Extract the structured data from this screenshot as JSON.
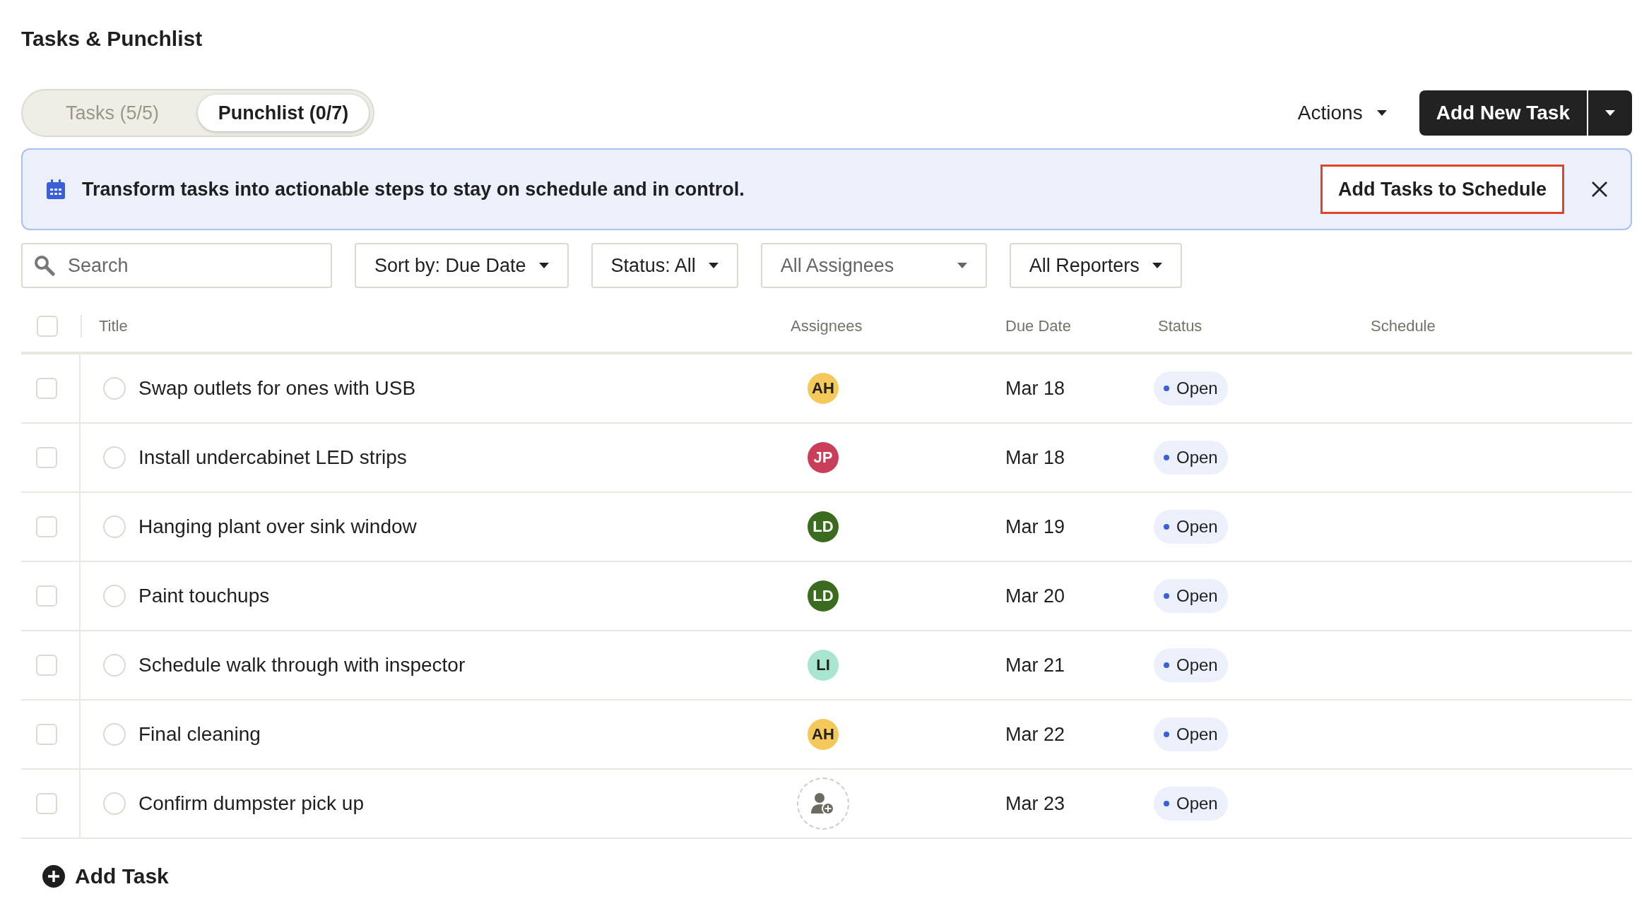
{
  "page_title": "Tasks & Punchlist",
  "tabs": [
    {
      "label": "Tasks (5/5)",
      "selected": false
    },
    {
      "label": "Punchlist (0/7)",
      "selected": true
    }
  ],
  "actions_menu": "Actions",
  "add_new_task": "Add New Task",
  "banner": {
    "message": "Transform tasks into actionable steps to stay on schedule and in control.",
    "button": "Add Tasks to Schedule"
  },
  "search": {
    "placeholder": "Search"
  },
  "filters": [
    {
      "label": "Sort by: Due Date",
      "placeholder": false
    },
    {
      "label": "Status: All",
      "placeholder": false
    },
    {
      "label": "All Assignees",
      "placeholder": true
    },
    {
      "label": "All Reporters",
      "placeholder": false
    }
  ],
  "table": {
    "select_all_checked": false,
    "columns": [
      "Title",
      "Assignees",
      "Due Date",
      "Status",
      "Schedule"
    ],
    "rows": [
      {
        "checked": false,
        "done": false,
        "title": "Swap outlets for ones with USB",
        "assignee": {
          "kind": "initials",
          "initials": "AH",
          "color": "#f5c85a"
        },
        "due_date": "Mar 18",
        "status": {
          "label": "Open",
          "color": "#3b5fdb"
        }
      },
      {
        "checked": false,
        "done": false,
        "title": "Install undercabinet LED strips",
        "assignee": {
          "kind": "initials",
          "initials": "JP",
          "color": "#c93f5a"
        },
        "due_date": "Mar 18",
        "status": {
          "label": "Open",
          "color": "#3b5fdb"
        }
      },
      {
        "checked": false,
        "done": false,
        "title": "Hanging plant over sink window",
        "assignee": {
          "kind": "initials",
          "initials": "LD",
          "color": "#3a6b1f"
        },
        "due_date": "Mar 19",
        "status": {
          "label": "Open",
          "color": "#3b5fdb"
        }
      },
      {
        "checked": false,
        "done": false,
        "title": "Paint touchups",
        "assignee": {
          "kind": "initials",
          "initials": "LD",
          "color": "#3a6b1f"
        },
        "due_date": "Mar 20",
        "status": {
          "label": "Open",
          "color": "#3b5fdb"
        }
      },
      {
        "checked": false,
        "done": false,
        "title": "Schedule walk through with inspector",
        "assignee": {
          "kind": "initials",
          "initials": "LI",
          "color": "#a8e6d0"
        },
        "due_date": "Mar 21",
        "status": {
          "label": "Open",
          "color": "#3b5fdb"
        }
      },
      {
        "checked": false,
        "done": false,
        "title": "Final cleaning",
        "assignee": {
          "kind": "initials",
          "initials": "AH",
          "color": "#f5c85a"
        },
        "due_date": "Mar 22",
        "status": {
          "label": "Open",
          "color": "#3b5fdb"
        }
      },
      {
        "checked": false,
        "done": false,
        "title": "Confirm dumpster pick up",
        "assignee": {
          "kind": "unassigned"
        },
        "due_date": "Mar 23",
        "status": {
          "label": "Open",
          "color": "#3b5fdb"
        }
      }
    ]
  },
  "add_task": "Add Task"
}
